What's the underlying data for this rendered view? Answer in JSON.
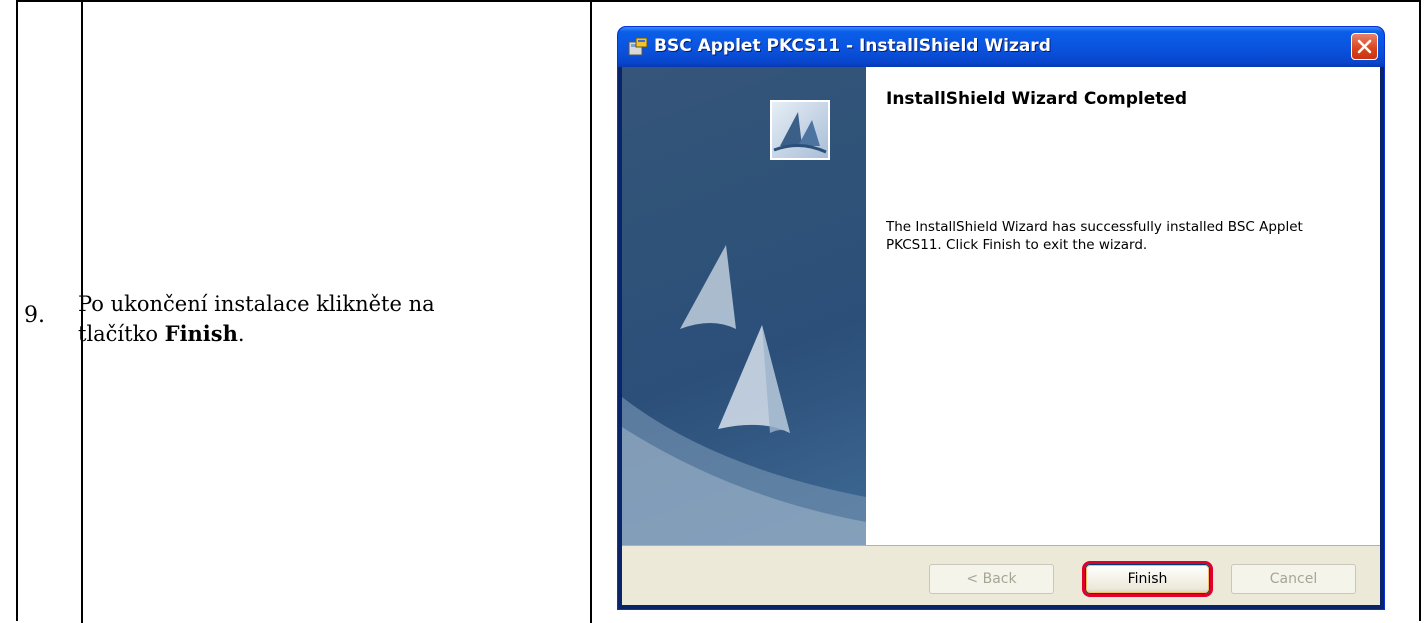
{
  "step": {
    "number": "9.",
    "instruction_prefix": "Po ukončení instalace klikněte na tlačítko",
    "instruction_bold": "Finish",
    "instruction_suffix": "."
  },
  "wizard": {
    "window_title": "BSC Applet PKCS11 - InstallShield Wizard",
    "heading": "InstallShield Wizard Completed",
    "message": "The InstallShield Wizard has successfully installed BSC Applet PKCS11. Click Finish to exit the wizard.",
    "buttons": {
      "back": "< Back",
      "finish": "Finish",
      "cancel": "Cancel"
    },
    "colors": {
      "titlebar": "#0a54e0",
      "banner": "#2e5278",
      "footer": "#ece9d8",
      "highlight": "#e0002b"
    }
  }
}
